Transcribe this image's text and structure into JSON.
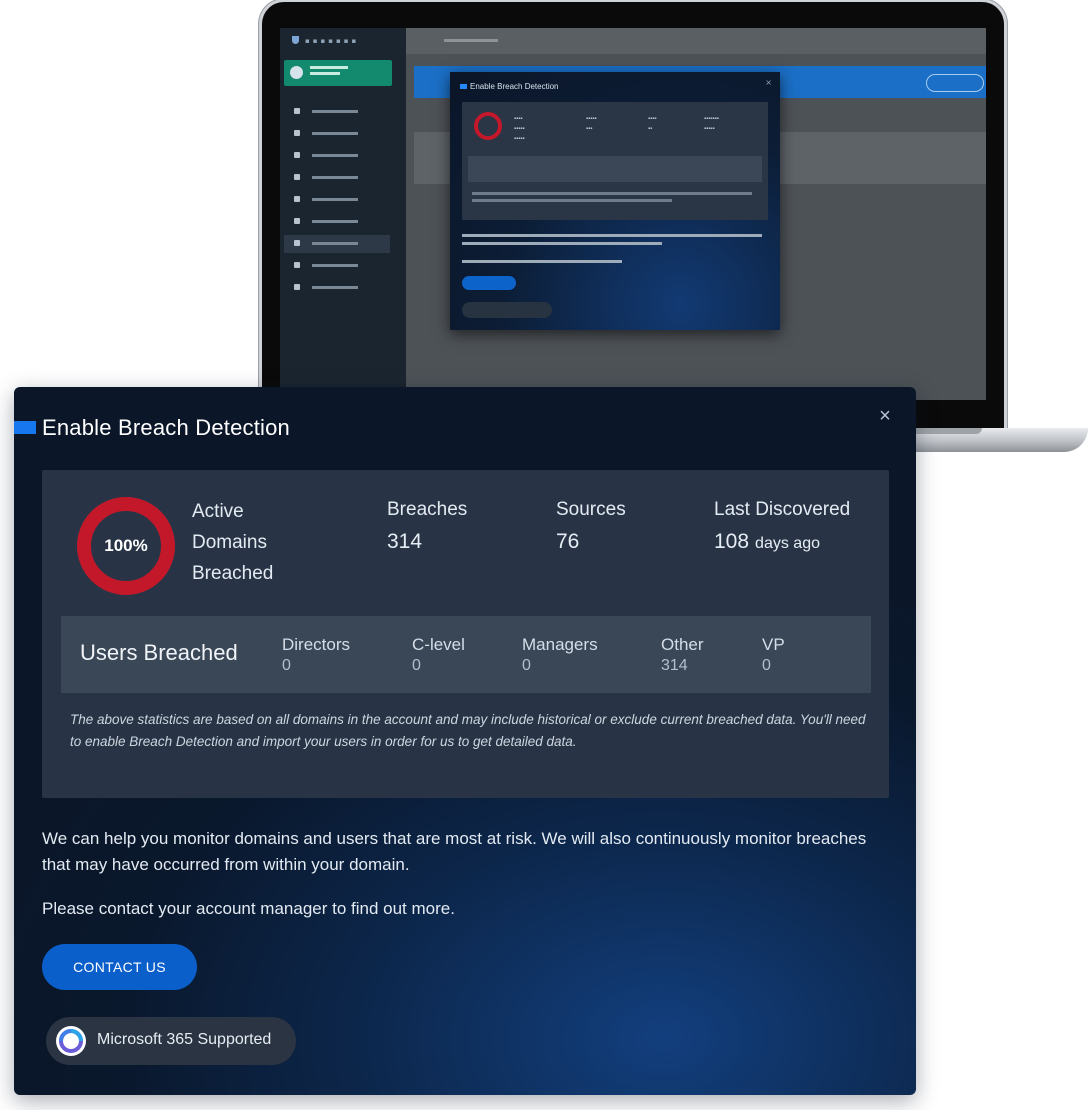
{
  "modal": {
    "title": "Enable Breach Detection",
    "close_glyph": "×"
  },
  "stats": {
    "percent_label": "100%",
    "percent_value": 1.0,
    "active_label_lines": [
      "Active",
      "Domains",
      "Breached"
    ],
    "breaches_label": "Breaches",
    "breaches_value": "314",
    "sources_label": "Sources",
    "sources_value": "76",
    "last_discovered_label": "Last Discovered",
    "last_discovered_value": "108",
    "last_discovered_unit": "days ago"
  },
  "users": {
    "title": "Users Breached",
    "roles": [
      {
        "label": "Directors",
        "value": "0"
      },
      {
        "label": "C-level",
        "value": "0"
      },
      {
        "label": "Managers",
        "value": "0"
      },
      {
        "label": "Other",
        "value": "314"
      },
      {
        "label": "VP",
        "value": "0"
      }
    ]
  },
  "stats_note": "The above statistics are based on all domains in the account and may include historical or exclude current breached data. You'll need to enable Breach Detection and import your users in order for us to get detailed data.",
  "body": {
    "paragraph1": "We can help you monitor domains and users that are most at risk. We will also continuously monitor breaches that may have occurred from within your domain.",
    "paragraph2": "Please contact your account manager to find out more."
  },
  "cta": {
    "contact_label": "CONTACT US"
  },
  "badge": {
    "microsoft_label": "Microsoft 365 Supported"
  },
  "colors": {
    "ring": "#c2182a",
    "ring_track": "#3a4757",
    "accent": "#1677ef",
    "button": "#0b5fcb"
  },
  "icons": {
    "close": "close-icon",
    "microsoft": "microsoft-365-icon",
    "title_accent": "title-accent-bar"
  }
}
